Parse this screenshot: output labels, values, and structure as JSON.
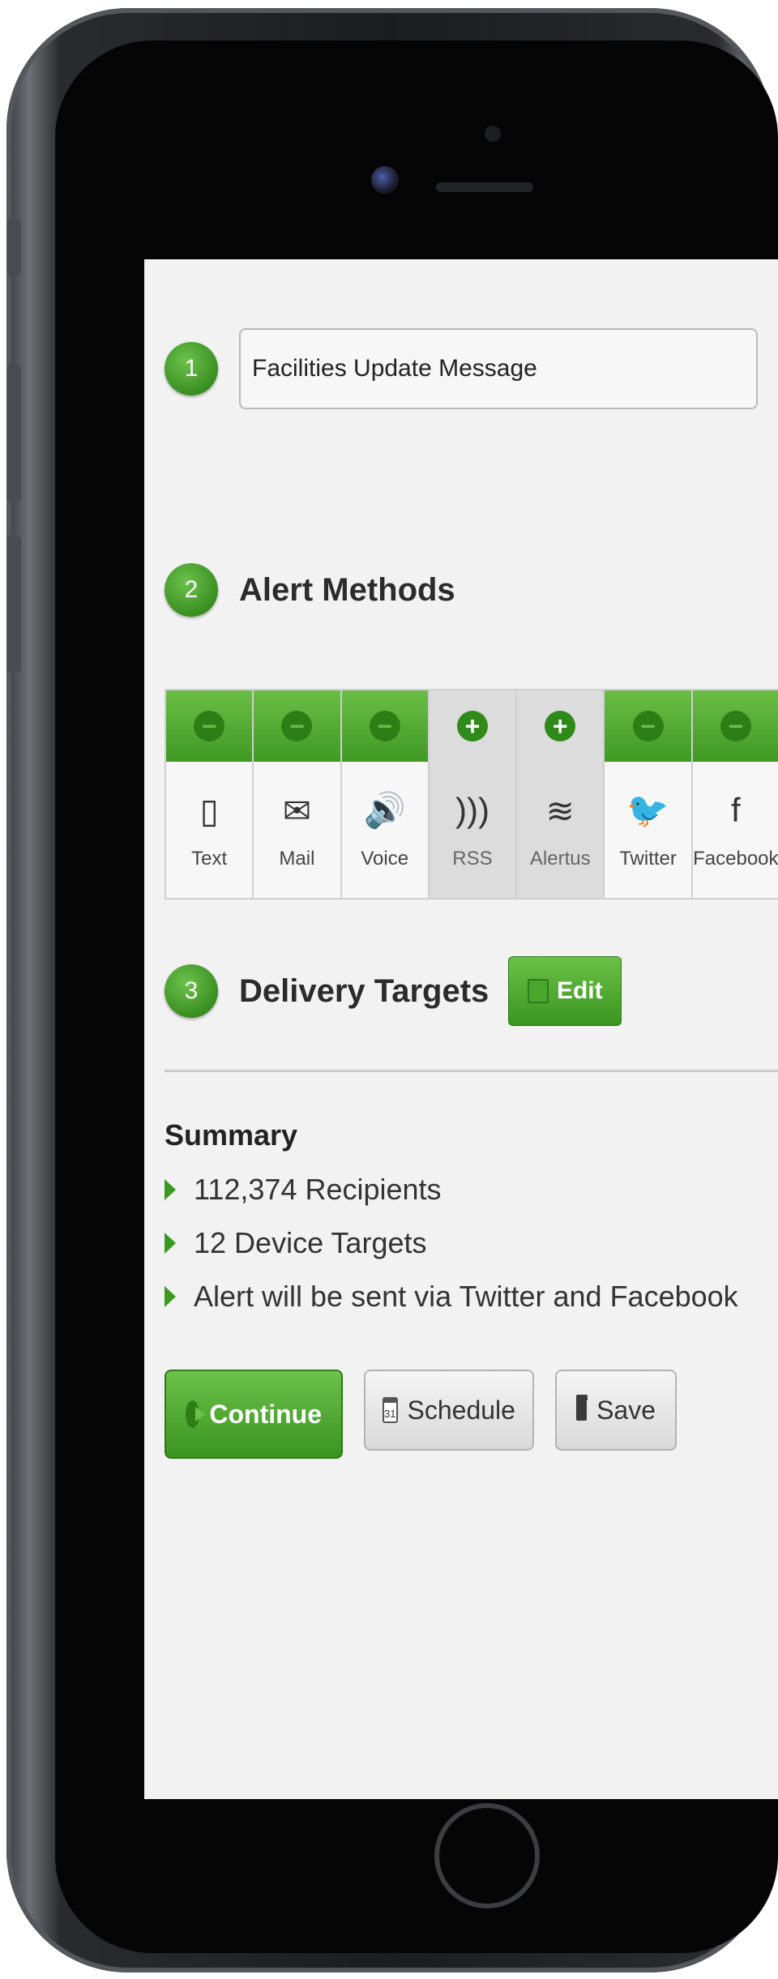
{
  "step1": {
    "number": "1",
    "message_value": "Facilities Update Message"
  },
  "step2": {
    "number": "2",
    "title": "Alert Methods",
    "methods": [
      {
        "label": "Text",
        "icon": "phone-icon",
        "glyph": "▯",
        "enabled": true
      },
      {
        "label": "Mail",
        "icon": "mail-icon",
        "glyph": "✉",
        "enabled": true
      },
      {
        "label": "Voice",
        "icon": "speaker-icon",
        "glyph": "🔊",
        "enabled": true
      },
      {
        "label": "RSS",
        "icon": "rss-icon",
        "glyph": ")))",
        "enabled": false
      },
      {
        "label": "Alertus",
        "icon": "wifi-icon",
        "glyph": "≋",
        "enabled": false
      },
      {
        "label": "Twitter",
        "icon": "twitter-bird-icon",
        "glyph": "🐦",
        "enabled": true
      },
      {
        "label": "Facebook",
        "icon": "facebook-icon",
        "glyph": "f",
        "enabled": true
      }
    ]
  },
  "step3": {
    "number": "3",
    "title": "Delivery Targets",
    "edit_label": "Edit"
  },
  "summary": {
    "title": "Summary",
    "items": [
      "112,374 Recipients",
      "12 Device Targets",
      "Alert will be sent via Twitter and Facebook"
    ]
  },
  "actions": {
    "continue_label": "Continue",
    "schedule_label": "Schedule",
    "calendar_day": "31",
    "save_label": "Save"
  },
  "colors": {
    "accent_green": "#3f9a24",
    "screen_bg": "#f2f2f2"
  }
}
